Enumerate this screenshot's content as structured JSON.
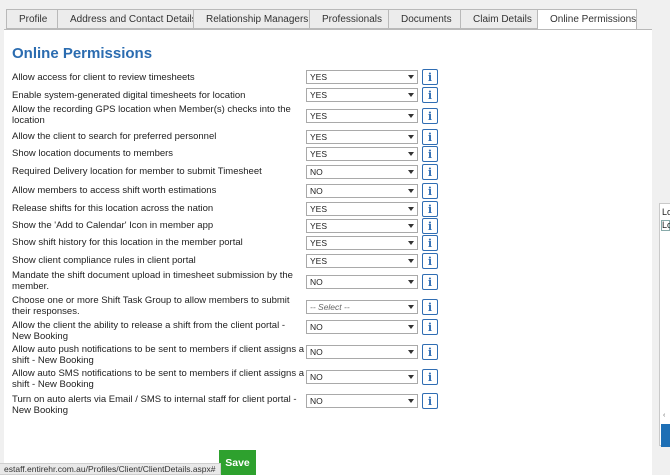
{
  "tabs": [
    {
      "label": "Profile",
      "active": false
    },
    {
      "label": "Address and Contact Details",
      "active": false
    },
    {
      "label": "Relationship Managers",
      "active": false
    },
    {
      "label": "Professionals",
      "active": false
    },
    {
      "label": "Documents",
      "active": false
    },
    {
      "label": "Claim Details",
      "active": false
    },
    {
      "label": "Online Permissions",
      "active": true
    }
  ],
  "section_title": "Online Permissions",
  "settings": [
    {
      "label": "Allow access for client to review timesheets",
      "value": "YES"
    },
    {
      "label": "Enable system-generated digital timesheets for location",
      "value": "YES"
    },
    {
      "label": "Allow the recording GPS location when Member(s) checks into the location",
      "value": "YES"
    },
    {
      "label": "Allow the client to search for preferred personnel",
      "value": "YES"
    },
    {
      "label": "Show location documents to members",
      "value": "YES"
    },
    {
      "label": "Required Delivery location for member to submit Timesheet",
      "value": "NO"
    },
    {
      "label": "Allow members to access shift worth estimations",
      "value": "NO"
    },
    {
      "label": "Release shifts for this location across the nation",
      "value": "YES"
    },
    {
      "label": "Show the 'Add to Calendar' Icon in member app",
      "value": "YES"
    },
    {
      "label": "Show shift history for this location in the member portal",
      "value": "YES"
    },
    {
      "label": "Show client compliance rules in client portal",
      "value": "YES"
    },
    {
      "label": "Mandate the shift document upload in timesheet submission by the member.",
      "value": "NO"
    },
    {
      "label": "Choose one or more Shift Task Group to allow members to submit their responses.",
      "value": "-- Select --"
    },
    {
      "label": "Allow the client the ability to release a shift from the client portal - New Booking",
      "value": "NO"
    },
    {
      "label": "Allow auto push notifications to be sent to members if client assigns a shift - New Booking",
      "value": "NO"
    },
    {
      "label": "Allow auto SMS notifications to be sent to members if client assigns a shift - New Booking",
      "value": "NO"
    },
    {
      "label": "Turn on auto alerts via Email / SMS to internal staff for client portal - New Booking",
      "value": "NO"
    }
  ],
  "info_icon_glyph": "i",
  "save_label": "Save",
  "status_url": "estaff.entirehr.com.au/Profiles/Client/ClientDetails.aspx#",
  "side_popup": {
    "line1": "Lo",
    "line2": "Lo"
  },
  "colors": {
    "title": "#2b6cb0",
    "save_button": "#2ea12e",
    "info_icon": "#2f6db3"
  }
}
